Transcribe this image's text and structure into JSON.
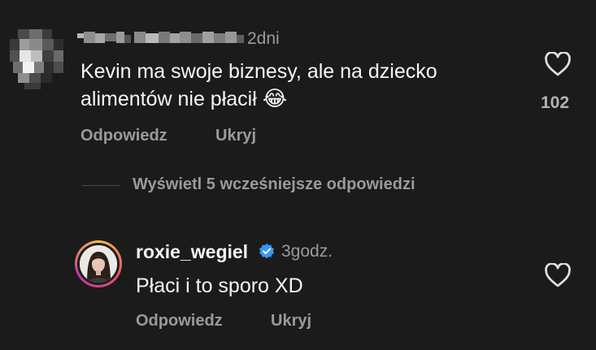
{
  "comment": {
    "time": "2dni",
    "text_line1": "Kevin ma swoje biznesy, ale na dziecko",
    "text_line2": "alimentów nie płacił",
    "emoji": "😂",
    "like_count": "102",
    "reply_label": "Odpowiedz",
    "hide_label": "Ukryj"
  },
  "view_replies_label": "Wyświetl 5 wcześniejsze odpowiedzi",
  "reply": {
    "username": "roxie_wegiel",
    "time": "3godz.",
    "text": "Płaci i to sporo XD",
    "reply_label": "Odpowiedz",
    "hide_label": "Ukryj"
  },
  "colors": {
    "background": "#1b1b1b",
    "text": "#f5f5f5",
    "muted": "#9a9a9a",
    "verified": "#3897f0"
  },
  "icons": {
    "like": "heart-outline-icon",
    "verified": "verified-badge-icon"
  }
}
